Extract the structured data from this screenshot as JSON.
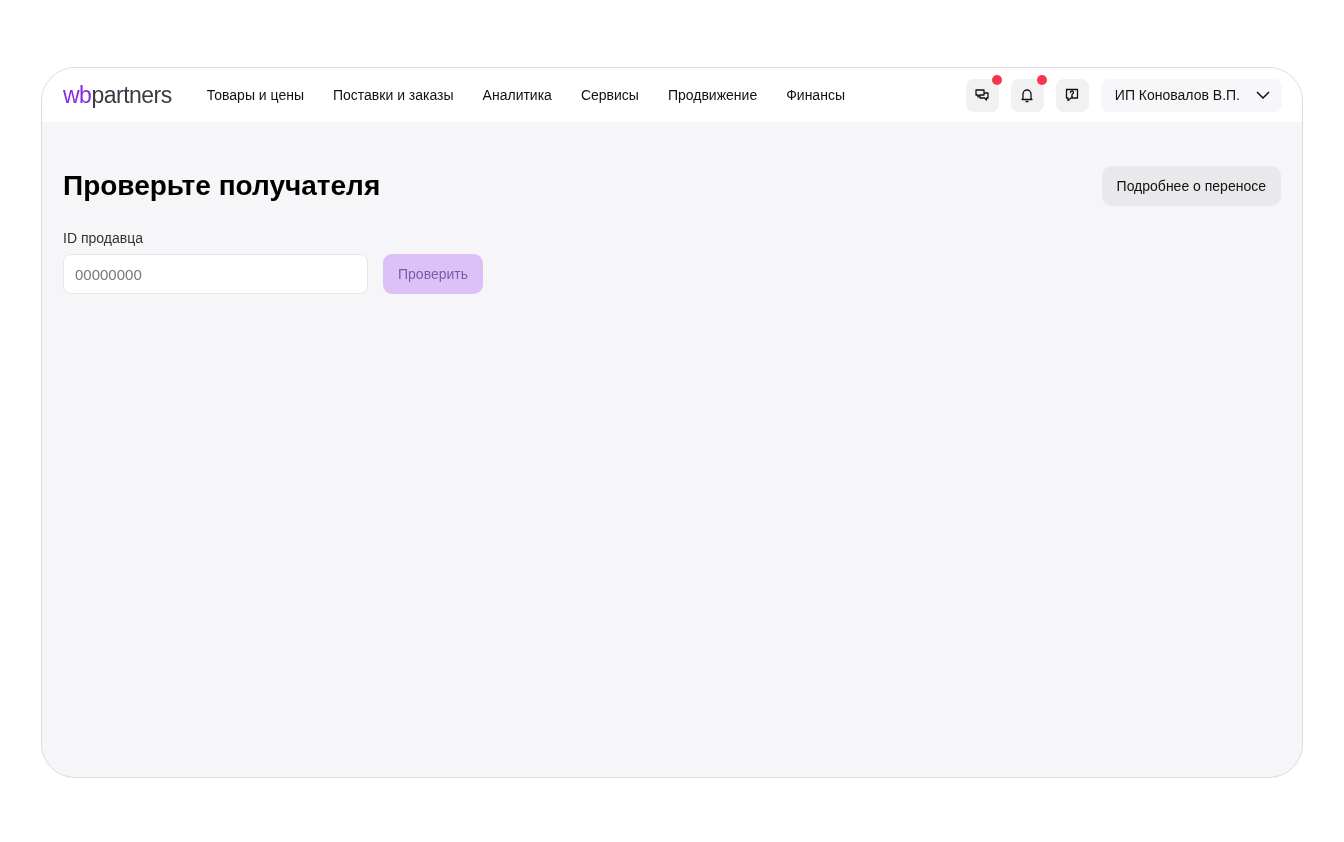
{
  "header": {
    "logo": {
      "accent": "wb",
      "rest": "partners"
    },
    "nav": [
      {
        "label": "Товары и цены"
      },
      {
        "label": "Поставки и заказы"
      },
      {
        "label": "Аналитика"
      },
      {
        "label": "Сервисы"
      },
      {
        "label": "Продвижение"
      },
      {
        "label": "Финансы"
      }
    ],
    "icons": [
      {
        "kind": "chats",
        "badge": true
      },
      {
        "kind": "bell",
        "badge": true
      },
      {
        "kind": "help",
        "badge": false
      }
    ],
    "account": {
      "name": "ИП Коновалов В.П."
    }
  },
  "page": {
    "title": "Проверьте получателя",
    "info_button": "Подробнее о переносе",
    "field": {
      "label": "ID продавца",
      "placeholder": "00000000"
    },
    "check_button": {
      "label": "Проверить",
      "disabled": true
    }
  }
}
